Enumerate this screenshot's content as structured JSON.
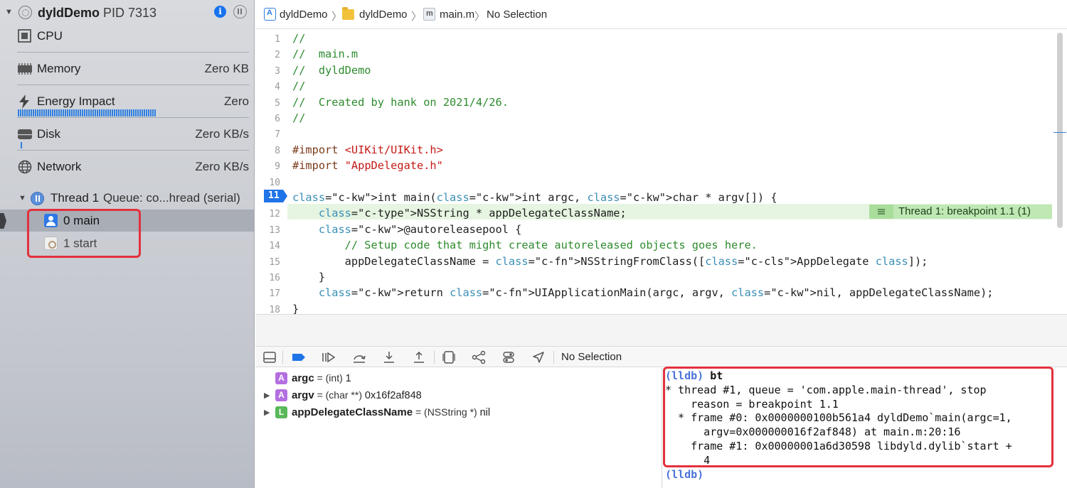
{
  "process": {
    "name": "dyldDemo",
    "pid": "PID 7313"
  },
  "gauges": [
    {
      "label": "CPU",
      "value": ""
    },
    {
      "label": "Memory",
      "value": "Zero KB"
    },
    {
      "label": "Energy Impact",
      "value": "Zero"
    },
    {
      "label": "Disk",
      "value": "Zero KB/s"
    },
    {
      "label": "Network",
      "value": "Zero KB/s"
    }
  ],
  "thread": {
    "label": "Thread 1",
    "queue": "Queue: co...hread (serial)"
  },
  "frames": [
    {
      "label": "0 main"
    },
    {
      "label": "1 start"
    }
  ],
  "breadcrumb": [
    "dyldDemo",
    "dyldDemo",
    "main.m",
    "No Selection"
  ],
  "code": {
    "current_line": "11",
    "breakpoint_label": "Thread 1: breakpoint 1.1 (1)",
    "lines": [
      {
        "n": "1",
        "text": "//"
      },
      {
        "n": "2",
        "text": "//  main.m"
      },
      {
        "n": "3",
        "text": "//  dyldDemo"
      },
      {
        "n": "4",
        "text": "//"
      },
      {
        "n": "5",
        "text": "//  Created by hank on 2021/4/26."
      },
      {
        "n": "6",
        "text": "//"
      },
      {
        "n": "7",
        "text": ""
      },
      {
        "n": "8",
        "text": "#import <UIKit/UIKit.h>"
      },
      {
        "n": "9",
        "text": "#import \"AppDelegate.h\""
      },
      {
        "n": "10",
        "text": ""
      },
      {
        "n": "11",
        "text": "int main(int argc, char * argv[]) {"
      },
      {
        "n": "12",
        "text": "    NSString * appDelegateClassName;"
      },
      {
        "n": "13",
        "text": "    @autoreleasepool {"
      },
      {
        "n": "14",
        "text": "        // Setup code that might create autoreleased objects goes here."
      },
      {
        "n": "15",
        "text": "        appDelegateClassName = NSStringFromClass([AppDelegate class]);"
      },
      {
        "n": "16",
        "text": "    }"
      },
      {
        "n": "17",
        "text": "    return UIApplicationMain(argc, argv, nil, appDelegateClassName);"
      },
      {
        "n": "18",
        "text": "}"
      }
    ]
  },
  "debugbar": {
    "label": "No Selection"
  },
  "variables": [
    {
      "kind": "A",
      "name": "argc",
      "type": " = (int) ",
      "value": "1",
      "expandable": false
    },
    {
      "kind": "A",
      "name": "argv",
      "type": " = (char **) ",
      "value": "0x16f2af848",
      "expandable": true
    },
    {
      "kind": "L",
      "name": "appDelegateClassName",
      "type": " = (NSString *) ",
      "value": "nil",
      "expandable": true
    }
  ],
  "console": {
    "prompt": "(lldb)",
    "command": "bt",
    "output": [
      "* thread #1, queue = 'com.apple.main-thread', stop",
      "    reason = breakpoint 1.1",
      "  * frame #0: 0x0000000100b561a4 dyldDemo`main(argc=1,",
      "      argv=0x000000016f2af848) at main.m:20:16",
      "    frame #1: 0x00000001a6d30598 libdyld.dylib`start +",
      "      4"
    ]
  },
  "colors": {
    "accent": "#1f74e8",
    "highlight_box": "#e3303d",
    "breakpoint_line": "#e6f5e1",
    "comment": "#2e8b2e"
  }
}
